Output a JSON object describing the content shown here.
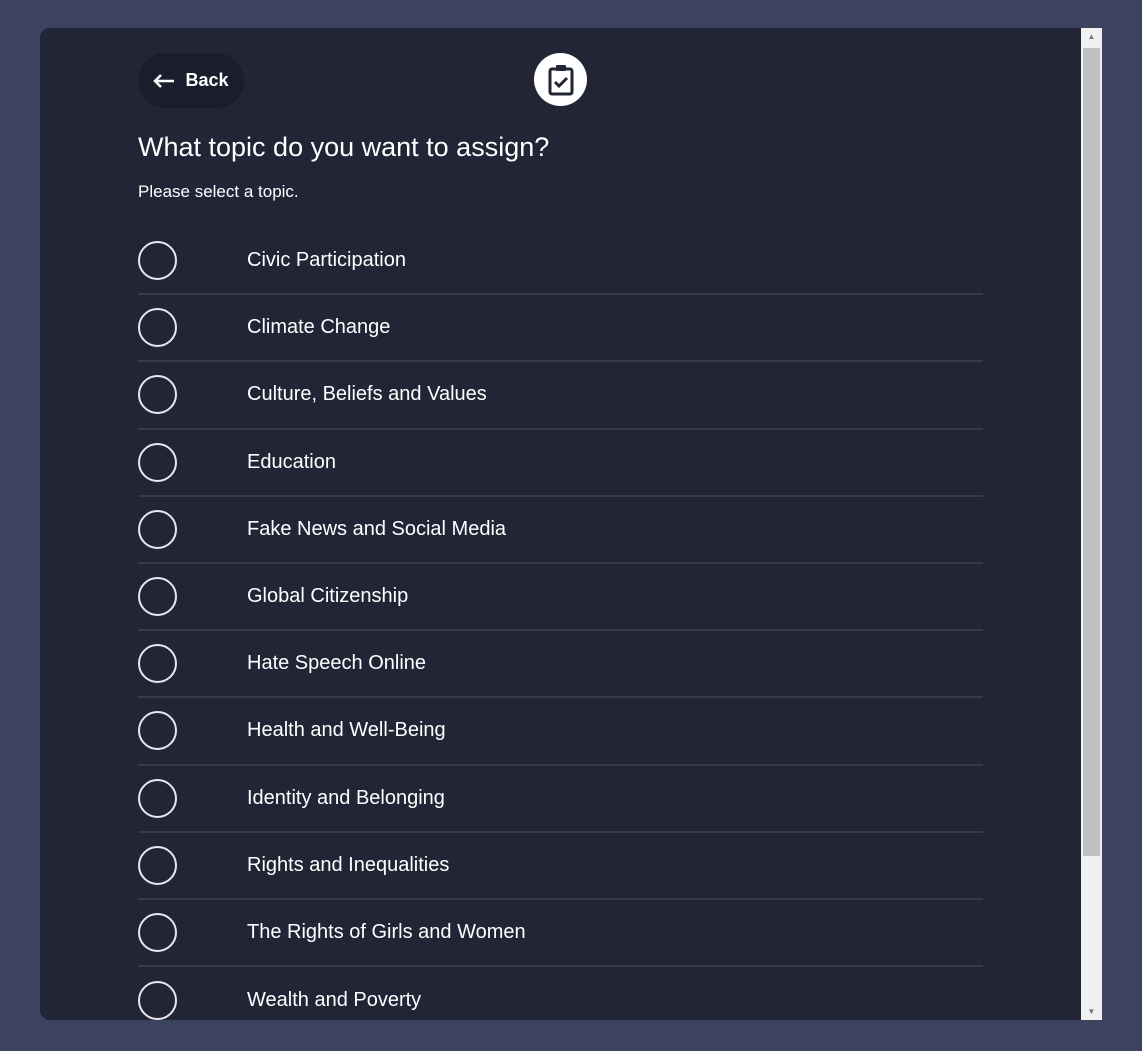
{
  "back_label": "Back",
  "icons": {
    "back": "arrow-left-icon",
    "header": "clipboard-check-icon"
  },
  "title": "What topic do you want to assign?",
  "subtitle": "Please select a topic.",
  "topics": [
    {
      "label": "Civic Participation",
      "selected": false
    },
    {
      "label": "Climate Change",
      "selected": false
    },
    {
      "label": "Culture, Beliefs and Values",
      "selected": false
    },
    {
      "label": "Education",
      "selected": false
    },
    {
      "label": "Fake News and Social Media",
      "selected": false
    },
    {
      "label": "Global Citizenship",
      "selected": false
    },
    {
      "label": "Hate Speech Online",
      "selected": false
    },
    {
      "label": "Health and Well-Being",
      "selected": false
    },
    {
      "label": "Identity and Belonging",
      "selected": false
    },
    {
      "label": "Rights and Inequalities",
      "selected": false
    },
    {
      "label": "The Rights of Girls and Women",
      "selected": false
    },
    {
      "label": "Wealth and Poverty",
      "selected": false
    }
  ]
}
